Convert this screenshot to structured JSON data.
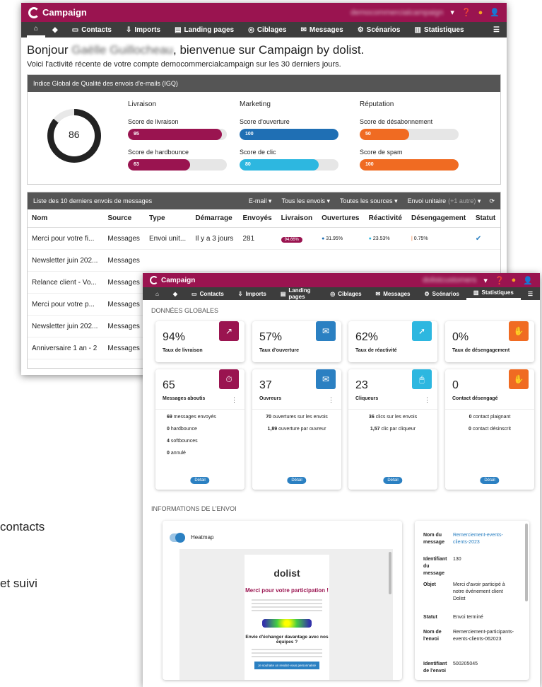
{
  "bg_fragments": [
    "contacts",
    "et suivi"
  ],
  "win1": {
    "logo": "Campaign",
    "logo_sub": "by dolist",
    "account": "democommercialcampaign",
    "nav": [
      {
        "icon": "home-icon",
        "label": ""
      },
      {
        "icon": "tag-icon",
        "label": ""
      },
      {
        "icon": "contacts-icon",
        "label": "Contacts"
      },
      {
        "icon": "import-icon",
        "label": "Imports"
      },
      {
        "icon": "page-icon",
        "label": "Landing pages"
      },
      {
        "icon": "target-icon",
        "label": "Ciblages"
      },
      {
        "icon": "mail-icon",
        "label": "Messages"
      },
      {
        "icon": "scenario-icon",
        "label": "Scénarios"
      },
      {
        "icon": "chart-icon",
        "label": "Statistiques"
      }
    ],
    "greeting_a": "Bonjour",
    "greeting_name": "Gaëlle Guillocheau",
    "greeting_b": ", bienvenue sur Campaign by dolist.",
    "subtitle": "Voici l'activité récente de votre compte democommercialcampaign sur les 30 derniers jours.",
    "iqg_title": "Indice Global de Qualité des envois d'e-mails (IGQ)",
    "iqg_value": "86",
    "iqg_fraction": 0.86,
    "columns": [
      {
        "title": "Livraison",
        "items": [
          {
            "label": "Score de livraison",
            "value": "95",
            "pct": 0.95,
            "color": "#9a1450"
          },
          {
            "label": "Score de hardbounce",
            "value": "63",
            "pct": 0.63,
            "color": "#9a1450"
          }
        ]
      },
      {
        "title": "Marketing",
        "items": [
          {
            "label": "Score d'ouverture",
            "value": "100",
            "pct": 1.0,
            "color": "#1f6fb4"
          },
          {
            "label": "Score de clic",
            "value": "80",
            "pct": 0.8,
            "color": "#2db7e0"
          }
        ]
      },
      {
        "title": "Réputation",
        "items": [
          {
            "label": "Score de désabonnement",
            "value": "50",
            "pct": 0.5,
            "color": "#f06b22"
          },
          {
            "label": "Score de spam",
            "value": "100",
            "pct": 1.0,
            "color": "#f06b22"
          }
        ]
      }
    ],
    "list_title": "Liste des 10 derniers envois de messages",
    "filters": [
      "E-mail",
      "Tous les envois",
      "Toutes les sources",
      "Envoi unitaire"
    ],
    "filter_note": "(+1 autre)",
    "headers": [
      "Nom",
      "Source",
      "Type",
      "Démarrage",
      "Envoyés",
      "Livraison",
      "Ouvertures",
      "Réactivité",
      "Désengagement",
      "Statut"
    ],
    "rows": [
      {
        "nom": "Merci pour votre fi...",
        "source": "Messages",
        "type": "Envoi unit...",
        "start": "Il y a 3 jours",
        "sent": "281",
        "liv": "94.66%",
        "ouv": "31.95%",
        "rea": "23.53%",
        "des": "0.75%"
      },
      {
        "nom": "Newsletter juin 202...",
        "source": "Messages"
      },
      {
        "nom": "Relance client - Vo...",
        "source": "Messages"
      },
      {
        "nom": "Merci pour votre p...",
        "source": "Messages"
      },
      {
        "nom": "Newsletter juin 202...",
        "source": "Messages"
      },
      {
        "nom": "Anniversaire 1 an - 2",
        "source": "Messages"
      }
    ]
  },
  "win2": {
    "logo": "Campaign",
    "account": "dolistcustomers",
    "nav": [
      {
        "icon": "home-icon",
        "label": ""
      },
      {
        "icon": "tag-icon",
        "label": ""
      },
      {
        "icon": "contacts-icon",
        "label": "Contacts"
      },
      {
        "icon": "import-icon",
        "label": "Imports"
      },
      {
        "icon": "page-icon",
        "label": "Landing pages"
      },
      {
        "icon": "target-icon",
        "label": "Ciblages"
      },
      {
        "icon": "mail-icon",
        "label": "Messages"
      },
      {
        "icon": "scenario-icon",
        "label": "Scénarios"
      },
      {
        "icon": "chart-icon",
        "label": "Statistiques"
      }
    ],
    "section1": "DONNÉES GLOBALES",
    "rates": [
      {
        "value": "94%",
        "label": "Taux de livraison",
        "color": "#9a1450",
        "icon": "delivery-rate-icon"
      },
      {
        "value": "57%",
        "label": "Taux d'ouverture",
        "color": "#2b80c2",
        "icon": "open-rate-icon"
      },
      {
        "value": "62%",
        "label": "Taux de réactivité",
        "color": "#2db7e0",
        "icon": "click-rate-icon"
      },
      {
        "value": "0%",
        "label": "Taux de désengagement",
        "color": "#f06b22",
        "icon": "unsubscribe-rate-icon"
      }
    ],
    "counts": [
      {
        "value": "65",
        "label": "Messages aboutis",
        "color": "#9a1450",
        "icon": "stopwatch-icon",
        "stats": [
          {
            "n": "69",
            "t": "messages envoyés"
          },
          {
            "n": "0",
            "t": "hardbounce"
          },
          {
            "n": "4",
            "t": "softbounces"
          },
          {
            "n": "0",
            "t": "annulé"
          }
        ]
      },
      {
        "value": "37",
        "label": "Ouvreurs",
        "color": "#2b80c2",
        "icon": "open-envelope-icon",
        "stats": [
          {
            "n": "70",
            "t": "ouvertures sur les envois"
          },
          {
            "n": "1,89",
            "t": "ouverture par ouvreur"
          }
        ]
      },
      {
        "value": "23",
        "label": "Cliqueurs",
        "color": "#2db7e0",
        "icon": "mouse-icon",
        "stats": [
          {
            "n": "36",
            "t": "clics sur les envois"
          },
          {
            "n": "1,57",
            "t": "clic par cliqueur"
          }
        ]
      },
      {
        "value": "0",
        "label": "Contact désengagé",
        "color": "#f06b22",
        "icon": "hand-icon",
        "stats": [
          {
            "n": "0",
            "t": "contact plaignant"
          },
          {
            "n": "0",
            "t": "contact désinscrit"
          }
        ]
      }
    ],
    "detail_label": "Détail",
    "section2": "INFORMATIONS DE L'ENVOI",
    "heatmap_label": "Heatmap",
    "email_brand": "dolist",
    "email_title": "Merci pour votre participation !",
    "email_h2": "Envie d'échanger davantage avec nos équipes ?",
    "email_btn": "Je souhaite un rendez-vous personnalisé",
    "details": [
      {
        "k": "Nom du message",
        "v": "Remerciement-events-clients-2023",
        "link": true
      },
      {
        "k": "Identifiant du message",
        "v": "130"
      },
      {
        "k": "Objet",
        "v": "Merci d'avoir participé à notre événement client Dolist"
      },
      {
        "k": "Statut",
        "v": "Envoi terminé"
      },
      {
        "k": "Nom de l'envoi",
        "v": "Remerciement-participants-events-clients-062023"
      },
      {
        "k": "Identifiant de l'envoi",
        "v": "500205045"
      }
    ]
  }
}
